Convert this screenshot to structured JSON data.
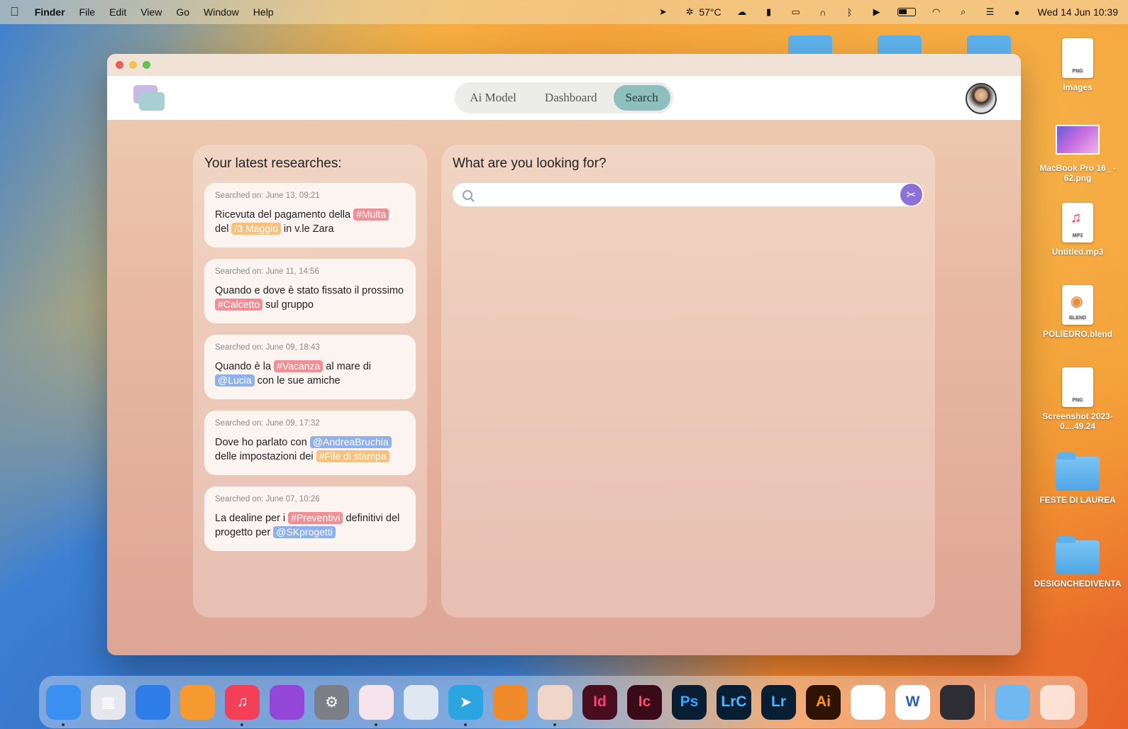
{
  "menubar": {
    "app_name": "Finder",
    "menus": [
      "File",
      "Edit",
      "View",
      "Go",
      "Window",
      "Help"
    ],
    "temperature": "57°C",
    "clock": "Wed 14 Jun  10:39"
  },
  "desktop": {
    "items": [
      {
        "label": "Images",
        "ext": "PNG",
        "kind": "file"
      },
      {
        "label": "MacBook Pro 16_ - 62.png",
        "kind": "thumb"
      },
      {
        "label": "Untitled.mp3",
        "ext": "MP3",
        "kind": "file"
      },
      {
        "label": "POLIEDRO.blend",
        "ext": "BLEND",
        "kind": "file"
      },
      {
        "label": "Screenshot 2023-0....49.24",
        "ext": "PNG",
        "kind": "file"
      },
      {
        "label": "FESTE DI LAUREA",
        "kind": "folder"
      },
      {
        "label": "DESIGNCHEDIVENTA",
        "kind": "folder"
      }
    ]
  },
  "app": {
    "nav": {
      "tabs": [
        "Ai Model",
        "Dashboard",
        "Search"
      ],
      "active": "Search"
    },
    "latest": {
      "title": "Your latest researches:",
      "cards": [
        {
          "date": "Searched on: June 13, 09:21",
          "parts": [
            {
              "t": "Ricevuta del pagamento della "
            },
            {
              "tag": "#Multa",
              "c": "red"
            },
            {
              "t": " del "
            },
            {
              "tag": "/3 Maggio",
              "c": "orange"
            },
            {
              "t": " in v.le Zara"
            }
          ]
        },
        {
          "date": "Searched on: June 11, 14:56",
          "parts": [
            {
              "t": "Quando e dove è stato fissato il prossimo "
            },
            {
              "tag": "#Calcetto",
              "c": "red"
            },
            {
              "t": " sul gruppo"
            }
          ]
        },
        {
          "date": "Searched on: June 09, 18:43",
          "parts": [
            {
              "t": "Quando è la "
            },
            {
              "tag": "#Vacanza",
              "c": "red"
            },
            {
              "t": " al mare di "
            },
            {
              "tag": "@Lucia",
              "c": "blue"
            },
            {
              "t": " con le sue amiche"
            }
          ]
        },
        {
          "date": "Searched on: June 09, 17:32",
          "parts": [
            {
              "t": "Dove ho parlato con "
            },
            {
              "tag": "@AndreaBruchia",
              "c": "blue"
            },
            {
              "t": " delle impostazioni dei "
            },
            {
              "tag": "#File di stampa",
              "c": "orange"
            }
          ]
        },
        {
          "date": "Searched on: June 07, 10:26",
          "parts": [
            {
              "t": "La dealine per i "
            },
            {
              "tag": "#Preventivi",
              "c": "red"
            },
            {
              "t": " definitivi del progetto per "
            },
            {
              "tag": "@SKprogetti",
              "c": "blue"
            }
          ]
        }
      ]
    },
    "search": {
      "title": "What are you looking for?",
      "value": "",
      "placeholder": ""
    }
  },
  "dock": {
    "apps": [
      {
        "name": "finder-icon",
        "label": "",
        "bg": "#3b8ff0",
        "running": true
      },
      {
        "name": "launchpad-icon",
        "label": "▦",
        "bg": "#e6e6ee",
        "running": false
      },
      {
        "name": "keynote-icon",
        "label": "",
        "bg": "#2f7de6",
        "running": false
      },
      {
        "name": "books-icon",
        "label": "",
        "bg": "#f49a2f",
        "running": false
      },
      {
        "name": "music-icon",
        "label": "♫",
        "bg": "#f43f58",
        "running": true
      },
      {
        "name": "podcasts-icon",
        "label": "",
        "bg": "#9446d8",
        "running": false
      },
      {
        "name": "system-settings-icon",
        "label": "⚙",
        "bg": "#7d7f86",
        "running": false
      },
      {
        "name": "affinity-icon",
        "label": "",
        "bg": "#f5e4ec",
        "running": true
      },
      {
        "name": "preview-icon",
        "label": "",
        "bg": "#dfe7f3",
        "running": false
      },
      {
        "name": "telegram-icon",
        "label": "➤",
        "bg": "#2aa5e0",
        "running": true
      },
      {
        "name": "blender-icon",
        "label": "",
        "bg": "#f18a2b",
        "running": false
      },
      {
        "name": "researches-app-icon",
        "label": "",
        "bg": "#efd6c8",
        "running": true
      },
      {
        "name": "indesign-icon",
        "label": "Id",
        "bg": "#4a0d1f",
        "fg": "#ff3d77",
        "running": false
      },
      {
        "name": "incopy-icon",
        "label": "Ic",
        "bg": "#3a0a18",
        "fg": "#ff4f62",
        "running": false
      },
      {
        "name": "photoshop-icon",
        "label": "Ps",
        "bg": "#0a1e33",
        "fg": "#32a8ff",
        "running": false
      },
      {
        "name": "lightroom-classic-icon",
        "label": "LrC",
        "bg": "#0a1e33",
        "fg": "#4bb6ff",
        "running": false
      },
      {
        "name": "lightroom-icon",
        "label": "Lr",
        "bg": "#0a1e33",
        "fg": "#4bb6ff",
        "running": false
      },
      {
        "name": "illustrator-icon",
        "label": "Ai",
        "bg": "#2f1300",
        "fg": "#ff9a00",
        "running": false
      },
      {
        "name": "vscode-icon",
        "label": "",
        "bg": "#ffffff",
        "running": false
      },
      {
        "name": "word-icon",
        "label": "W",
        "bg": "#ffffff",
        "fg": "#2b5fbf",
        "running": false
      },
      {
        "name": "davinci-resolve-icon",
        "label": "",
        "bg": "#2d2d33",
        "running": false
      }
    ]
  }
}
